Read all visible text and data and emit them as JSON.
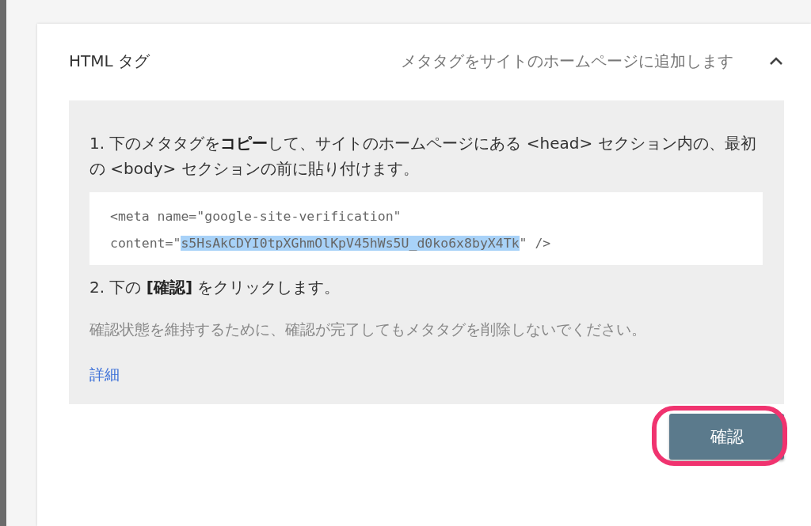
{
  "section": {
    "title": "HTML タグ",
    "subtitle": "メタタグをサイトのホームページに追加します",
    "expanded": true
  },
  "steps": [
    {
      "kind": "instruction",
      "text": "1. 下のメタタグを**コピー**して、サイトのホームページにある <head> セクション内の、最初の <body> セクションの前に貼り付けます。"
    },
    {
      "kind": "code",
      "lines": [
        [
          {
            "text": "<meta name=\"google-site-verification\"",
            "selected": false
          }
        ],
        [
          {
            "text": "content=\"",
            "selected": false
          },
          {
            "text": "s5HsAkCDYI0tpXGhmOlKpV45hWs5U_d0ko6x8byX4Tk",
            "selected": true
          },
          {
            "text": "\" />",
            "selected": false
          }
        ]
      ]
    },
    {
      "kind": "instruction",
      "text": "2. 下の **[確認]** をクリックします。"
    },
    {
      "kind": "note",
      "text": "確認状態を維持するために、確認が完了してもメタタグを削除しないでください。"
    },
    {
      "kind": "link",
      "text": "詳細"
    }
  ],
  "button": {
    "label": "確認",
    "highlighted": true
  }
}
